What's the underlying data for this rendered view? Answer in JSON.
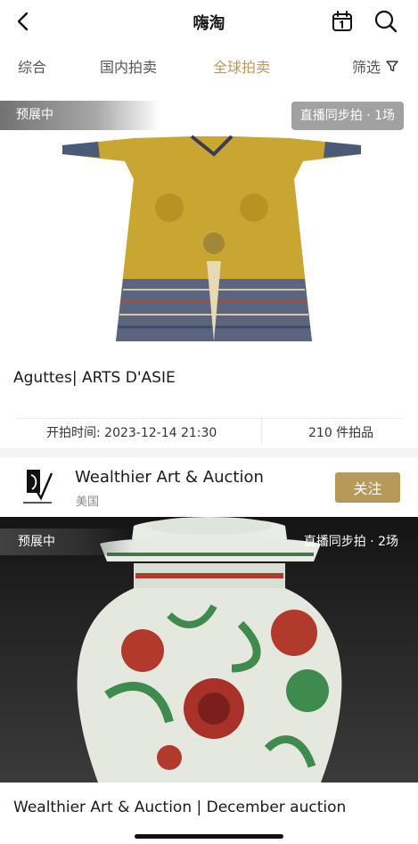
{
  "nav": {
    "title": "嗨淘"
  },
  "tabs": [
    {
      "label": "综合",
      "active": false
    },
    {
      "label": "国内拍卖",
      "active": false
    },
    {
      "label": "全球拍卖",
      "active": true
    },
    {
      "label": "筛选",
      "active": false
    }
  ],
  "accent_color": "#b79a5a",
  "auctions": [
    {
      "status": "预展中",
      "live_badge": "直播同步拍 · 1场",
      "title": "Aguttes| ARTS D'ASIE",
      "start_time": "开拍时间: 2023-12-14 21:30",
      "lot_count": "210 件拍品"
    },
    {
      "status": "预展中",
      "live_badge": "直播同步拍 · 2场",
      "title": "Wealthier Art & Auction | December auction"
    }
  ],
  "auctioneer": {
    "name": "Wealthier Art & Auction",
    "region": "美国",
    "follow_label": "关注"
  }
}
